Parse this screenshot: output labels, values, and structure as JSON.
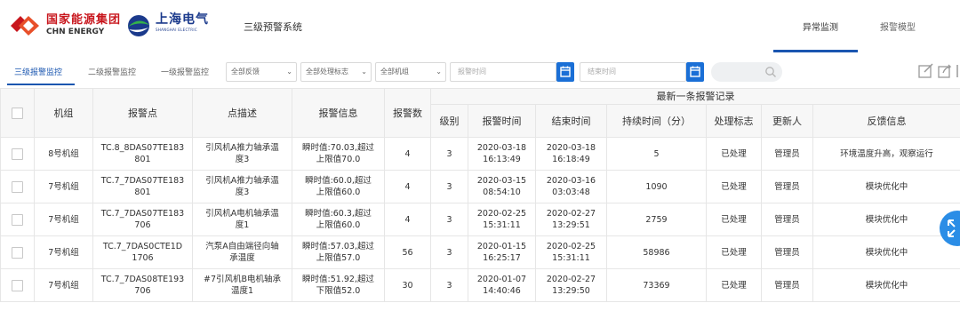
{
  "header": {
    "logo1_cn": "国家能源集团",
    "logo1_en": "CHN ENERGY",
    "logo2_cn": "上海电气",
    "logo2_en": "SHANGHAI ELECTRIC",
    "system_title": "三级预警系统",
    "nav": [
      {
        "label": "异常监测"
      },
      {
        "label": "报警模型"
      }
    ]
  },
  "filters": {
    "tabs": [
      {
        "label": "三级报警监控"
      },
      {
        "label": "二级报警监控"
      },
      {
        "label": "一级报警监控"
      }
    ],
    "feedback_select": "全部反馈",
    "handling_select": "全部处理标志",
    "unit_select": "全部机组",
    "start_time_placeholder": "报警时间",
    "end_time_placeholder": "结束时间"
  },
  "table": {
    "group_header": "最新一条报警记录",
    "columns": [
      "机组",
      "报警点",
      "点描述",
      "报警信息",
      "报警数",
      "级别",
      "报警时间",
      "结束时间",
      "持续时间（分）",
      "处理标志",
      "更新人",
      "反馈信息"
    ],
    "rows": [
      {
        "unit": "8号机组",
        "point": "TC.8_8DAS07TE183\n801",
        "desc": "引风机A推力轴承温\n度3",
        "info": "瞬时值:70.03,超过\n上限值70.0",
        "count": "4",
        "level": "3",
        "alarm_time": "2020-03-18\n16:13:49",
        "end_time": "2020-03-18\n16:18:49",
        "duration": "5",
        "flag": "已处理",
        "updater": "管理员",
        "feedback": "环境温度升高，观察运行"
      },
      {
        "unit": "7号机组",
        "point": "TC.7_7DAS07TE183\n801",
        "desc": "引风机A推力轴承温\n度3",
        "info": "瞬时值:60.0,超过\n上限值60.0",
        "count": "4",
        "level": "3",
        "alarm_time": "2020-03-15\n08:54:10",
        "end_time": "2020-03-16\n03:03:48",
        "duration": "1090",
        "flag": "已处理",
        "updater": "管理员",
        "feedback": "模块优化中"
      },
      {
        "unit": "7号机组",
        "point": "TC.7_7DAS07TE183\n706",
        "desc": "引风机A电机轴承温\n度1",
        "info": "瞬时值:60.3,超过\n上限值60.0",
        "count": "4",
        "level": "3",
        "alarm_time": "2020-02-25\n15:31:11",
        "end_time": "2020-02-27\n13:29:51",
        "duration": "2759",
        "flag": "已处理",
        "updater": "管理员",
        "feedback": "模块优化中"
      },
      {
        "unit": "7号机组",
        "point": "TC.7_7DAS0CTE1D\n1706",
        "desc": "汽泵A自由端径向轴\n承温度",
        "info": "瞬时值:57.03,超过\n上限值57.0",
        "count": "56",
        "level": "3",
        "alarm_time": "2020-01-15\n16:25:17",
        "end_time": "2020-02-25\n15:31:11",
        "duration": "58986",
        "flag": "已处理",
        "updater": "管理员",
        "feedback": "模块优化中"
      },
      {
        "unit": "7号机组",
        "point": "TC.7_7DAS08TE193\n706",
        "desc": "#7引风机B电机轴承\n温度1",
        "info": "瞬时值:51.92,超过\n下限值52.0",
        "count": "30",
        "level": "3",
        "alarm_time": "2020-01-07\n14:40:46",
        "end_time": "2020-02-27\n13:29:50",
        "duration": "73369",
        "flag": "已处理",
        "updater": "管理员",
        "feedback": "模块优化中"
      }
    ]
  }
}
